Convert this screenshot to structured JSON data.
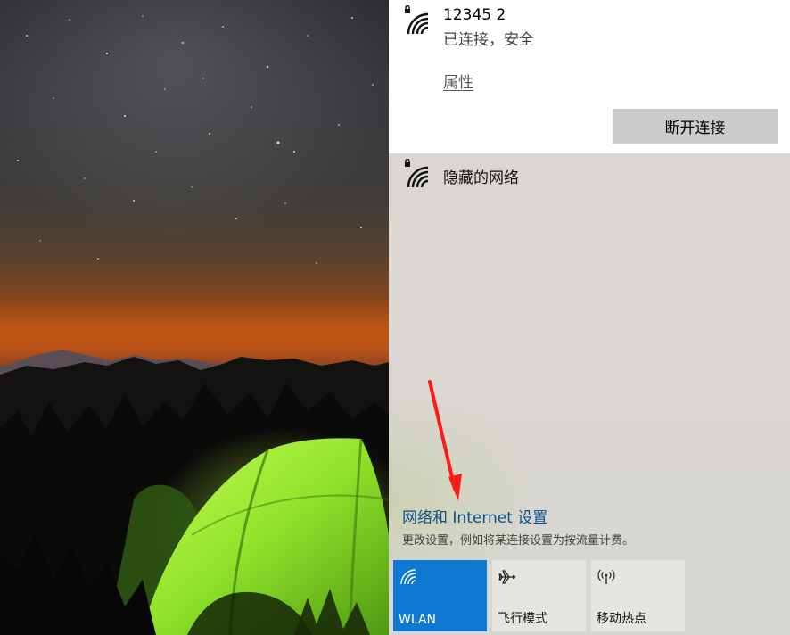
{
  "connected_network": {
    "name": "12345 2",
    "status": "已连接，安全",
    "properties_link": "属性",
    "disconnect_button": "断开连接",
    "icon": "wifi-secured-icon"
  },
  "other_networks": [
    {
      "name": "隐藏的网络",
      "icon": "wifi-secured-icon"
    }
  ],
  "settings": {
    "link": "网络和 Internet 设置",
    "description": "更改设置，例如将某连接设置为按流量计费。"
  },
  "quick_actions": [
    {
      "label": "WLAN",
      "icon": "wifi-icon",
      "active": true
    },
    {
      "label": "飞行模式",
      "icon": "airplane-icon",
      "active": false
    },
    {
      "label": "移动热点",
      "icon": "hotspot-icon",
      "active": false
    }
  ],
  "colors": {
    "accent": "#0f78d3",
    "link": "#0b4f8a",
    "annotation_arrow": "#ff1a1a"
  }
}
